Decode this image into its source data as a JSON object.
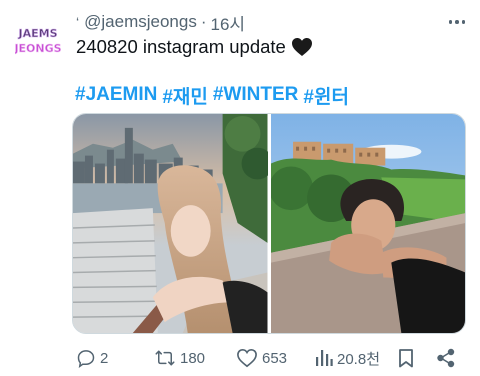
{
  "avatar": {
    "text_line1": "JAEMS",
    "text_line2": "JEONGS"
  },
  "tweet": {
    "verified_glyph": "‘",
    "handle": "@jaemsjeongs",
    "separator": "·",
    "time": "16시",
    "text": "240820 instagram update",
    "emoji": "black-heart",
    "hashtags": [
      "#JAEMIN",
      "#재민",
      "#WINTER",
      "#윈터"
    ]
  },
  "media": {
    "photos": [
      {
        "description": "winter-leaning-on-railing-city-skyline"
      },
      {
        "description": "jaemin-leaning-on-railing-green-hills"
      }
    ]
  },
  "actions": {
    "reply_count": "2",
    "retweet_count": "180",
    "like_count": "653",
    "view_count": "20.8천"
  },
  "colors": {
    "link": "#1d9bf0",
    "secondary_text": "#536471",
    "primary_text": "#0f1419",
    "border": "#cfd9de"
  }
}
